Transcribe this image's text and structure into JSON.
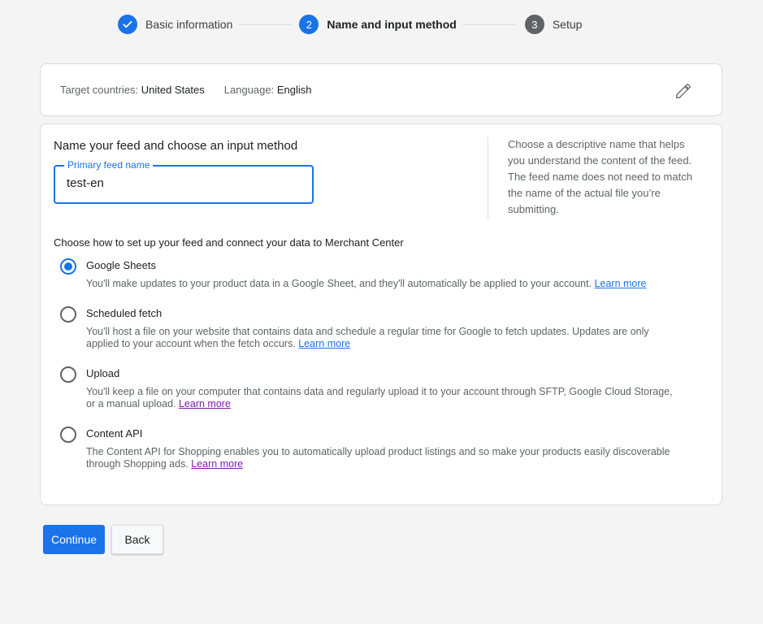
{
  "stepper": {
    "steps": [
      {
        "label": "Basic information",
        "state": "done"
      },
      {
        "label": "Name and input method",
        "number": "2",
        "state": "active"
      },
      {
        "label": "Setup",
        "number": "3",
        "state": "pending"
      }
    ]
  },
  "summary": {
    "country_key": "Target countries:",
    "country_value": "United States",
    "language_key": "Language:",
    "language_value": "English",
    "edit_icon": "pencil-icon"
  },
  "main": {
    "title": "Name your feed and choose an input method",
    "feed_name": {
      "label": "Primary feed name",
      "value": "test-en"
    },
    "help_text": "Choose a descriptive name that helps you understand the content of the feed. The feed name does not need to match the name of the actual file you’re submitting.",
    "method_title": "Choose how to set up your feed and connect your data to Merchant Center",
    "options": [
      {
        "label": "Google Sheets",
        "checked": true,
        "desc": "You'll make updates to your product data in a Google Sheet, and they'll automatically be applied to your account.",
        "link": "Learn more"
      },
      {
        "label": "Scheduled fetch",
        "checked": false,
        "desc": "You'll host a file on your website that contains data and schedule a regular time for Google to fetch updates. Updates are only applied to your account when the fetch occurs.",
        "link": "Learn more"
      },
      {
        "label": "Upload",
        "checked": false,
        "desc": "You'll keep a file on your computer that contains data and regularly upload it to your account through SFTP, Google Cloud Storage, or a manual upload.",
        "link": "Learn more"
      },
      {
        "label": "Content API",
        "checked": false,
        "desc": "The Content API for Shopping enables you to automatically upload product listings and so make your products easily discoverable through Shopping ads.",
        "link": "Learn more"
      }
    ]
  },
  "actions": {
    "continue_label": "Continue",
    "back_label": "Back"
  },
  "colors": {
    "accent": "#1a73e8",
    "visited_link": "#7b1fa2"
  }
}
